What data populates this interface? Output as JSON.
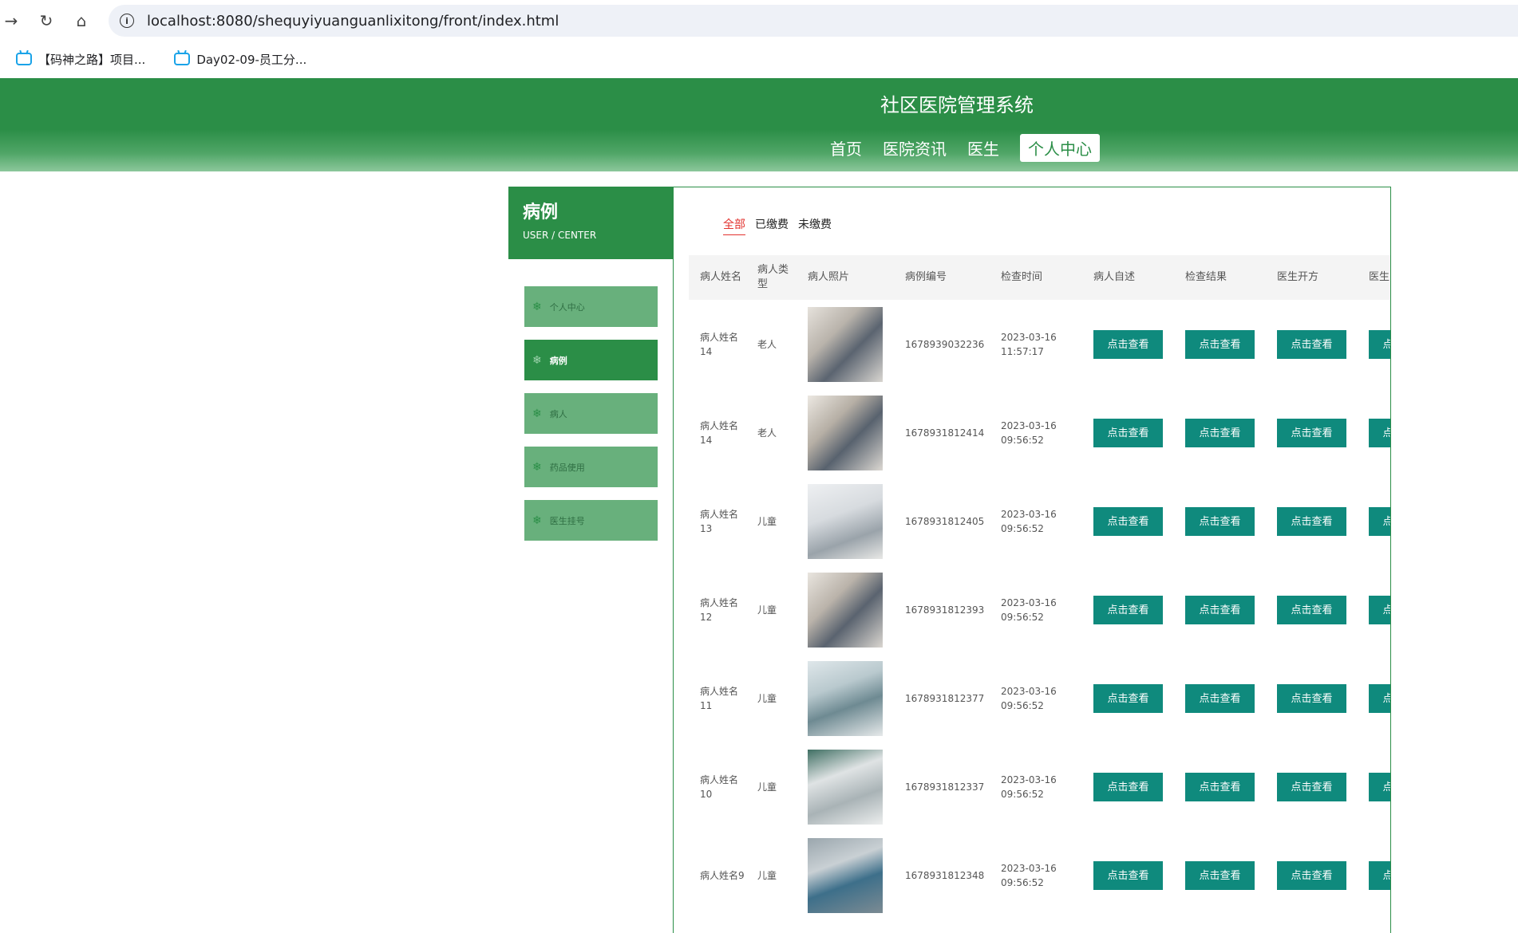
{
  "browser": {
    "url_host": "localhost",
    "url_rest": ":8080/shequyiyuanguanlixitong/front/index.html",
    "bookmarks": [
      {
        "label": "【码神之路】项目..."
      },
      {
        "label": "Day02-09-员工分..."
      }
    ]
  },
  "header": {
    "title": "社区医院管理系统",
    "nav": [
      {
        "label": "首页"
      },
      {
        "label": "医院资讯"
      },
      {
        "label": "医生"
      },
      {
        "label": "个人中心"
      }
    ],
    "active_nav": "个人中心"
  },
  "sidebar": {
    "title": "病例",
    "subtitle": "USER / CENTER",
    "items": [
      {
        "label": "个人中心"
      },
      {
        "label": "病例"
      },
      {
        "label": "病人"
      },
      {
        "label": "药品使用"
      },
      {
        "label": "医生挂号"
      }
    ],
    "active_item": "病例"
  },
  "filters": {
    "tabs": [
      {
        "label": "全部"
      },
      {
        "label": "已缴费"
      },
      {
        "label": "未缴费"
      }
    ],
    "active": "全部"
  },
  "table": {
    "headers": [
      "病人姓名",
      "病人类型",
      "病人照片",
      "病例编号",
      "检查时间",
      "病人自述",
      "检查结果",
      "医生开方",
      "医生"
    ],
    "button_label": "点击查看",
    "rows": [
      {
        "name": "病人姓名14",
        "type": "老人",
        "case_no": "1678939032236",
        "date": "2023-03-16",
        "time": "11:57:17"
      },
      {
        "name": "病人姓名14",
        "type": "老人",
        "case_no": "1678931812414",
        "date": "2023-03-16",
        "time": "09:56:52"
      },
      {
        "name": "病人姓名13",
        "type": "儿童",
        "case_no": "1678931812405",
        "date": "2023-03-16",
        "time": "09:56:52"
      },
      {
        "name": "病人姓名12",
        "type": "儿童",
        "case_no": "1678931812393",
        "date": "2023-03-16",
        "time": "09:56:52"
      },
      {
        "name": "病人姓名11",
        "type": "儿童",
        "case_no": "1678931812377",
        "date": "2023-03-16",
        "time": "09:56:52"
      },
      {
        "name": "病人姓名10",
        "type": "儿童",
        "case_no": "1678931812337",
        "date": "2023-03-16",
        "time": "09:56:52"
      },
      {
        "name": "病人姓名9",
        "type": "儿童",
        "case_no": "1678931812348",
        "date": "2023-03-16",
        "time": "09:56:52"
      }
    ]
  }
}
